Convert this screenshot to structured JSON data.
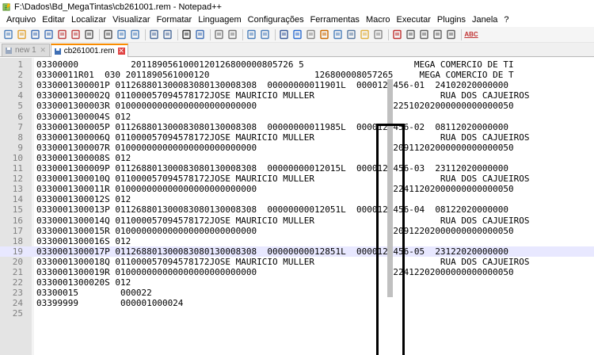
{
  "window": {
    "title": "F:\\Dados\\Bd_MegaTintas\\cb261001.rem - Notepad++",
    "icon": "notepad-plus-plus-icon"
  },
  "menu": [
    "Arquivo",
    "Editar",
    "Localizar",
    "Visualizar",
    "Formatar",
    "Linguagem",
    "Configurações",
    "Ferramentas",
    "Macro",
    "Executar",
    "Plugins",
    "Janela",
    "?"
  ],
  "toolbar": {
    "icons": [
      "new-file-icon",
      "open-file-icon",
      "save-icon",
      "save-all-icon",
      "close-icon",
      "close-all-icon",
      "print-icon",
      "cut-icon",
      "copy-icon",
      "paste-icon",
      "undo-icon",
      "redo-icon",
      "find-icon",
      "replace-icon",
      "zoom-in-icon",
      "zoom-out-icon",
      "sync-vertical-icon",
      "sync-horizontal-icon",
      "word-wrap-icon",
      "show-all-chars-icon",
      "indent-guide-icon",
      "user-language-icon",
      "document-map-icon",
      "function-list-icon",
      "folder-workspace-icon",
      "monitoring-icon",
      "record-macro-icon",
      "stop-macro-icon",
      "play-macro-icon",
      "run-macro-multiple-icon",
      "save-macro-icon",
      "spellcheck-icon"
    ],
    "spellcheck_label": "ABC"
  },
  "tabs": [
    {
      "label": "new 1",
      "active": false
    },
    {
      "label": "cb261001.rem",
      "active": true
    }
  ],
  "close_glyph": "✕",
  "editor": {
    "current_line": 19,
    "lines": [
      {
        "n": "1",
        "text": "03300000          2011890561000120126800000805726 5                     MEGA COMERCIO DE TI"
      },
      {
        "n": "2",
        "text": "03300011R01  030 2011890561000120                    126800008057265     MEGA COMERCIO DE T"
      },
      {
        "n": "3",
        "text": "0330001300001P 011268801300083080130008308  00000000011901L  0000123456-01  24102020000000"
      },
      {
        "n": "4",
        "text": "0330001300002Q 011000057094578172JOSE MAURICIO MULLER                        RUA DOS CAJUEIROS"
      },
      {
        "n": "5",
        "text": "0330001300003R 010000000000000000000000000                          22510202000000000000050"
      },
      {
        "n": "6",
        "text": "0330001300004S 012"
      },
      {
        "n": "7",
        "text": "0330001300005P 011268801300083080130008308  00000000011985L  0000123456-02  08112020000000"
      },
      {
        "n": "8",
        "text": "0330001300006Q 011000057094578172JOSE MAURICIO MULLER                        RUA DOS CAJUEIROS"
      },
      {
        "n": "9",
        "text": "0330001300007R 010000000000000000000000000                          20911202000000000000050"
      },
      {
        "n": "10",
        "text": "0330001300008S 012"
      },
      {
        "n": "11",
        "text": "0330001300009P 011268801300083080130008308  00000000012015L  0000123456-03  23112020000000"
      },
      {
        "n": "12",
        "text": "0330001300010Q 011000057094578172JOSE MAURICIO MULLER                        RUA DOS CAJUEIROS"
      },
      {
        "n": "13",
        "text": "0330001300011R 010000000000000000000000000                          22411202000000000000050"
      },
      {
        "n": "14",
        "text": "0330001300012S 012"
      },
      {
        "n": "15",
        "text": "0330001300013P 011268801300083080130008308  00000000012051L  0000123456-04  08122020000000"
      },
      {
        "n": "16",
        "text": "0330001300014Q 011000057094578172JOSE MAURICIO MULLER                        RUA DOS CAJUEIROS"
      },
      {
        "n": "17",
        "text": "0330001300015R 010000000000000000000000000                          20912202000000000000050"
      },
      {
        "n": "18",
        "text": "0330001300016S 012"
      },
      {
        "n": "19",
        "text": "0330001300017P 011268801300083080130008308  00000000012851L  0000123456-05  23122020000000"
      },
      {
        "n": "20",
        "text": "0330001300018Q 011000057094578172JOSE MAURICIO MULLER                        RUA DOS CAJUEIROS"
      },
      {
        "n": "21",
        "text": "0330001300019R 010000000000000000000000000                          22412202000000000000050"
      },
      {
        "n": "22",
        "text": "0330001300020S 012"
      },
      {
        "n": "23",
        "text": "03300015        000022"
      },
      {
        "n": "24",
        "text": "03399999        000001000024"
      },
      {
        "n": "25",
        "text": ""
      }
    ]
  },
  "colors": {
    "accent_tab": "#fa8c00",
    "close_active": "#e04343",
    "current_line": "#e8e8ff",
    "gutter": "#e4e4e4"
  }
}
